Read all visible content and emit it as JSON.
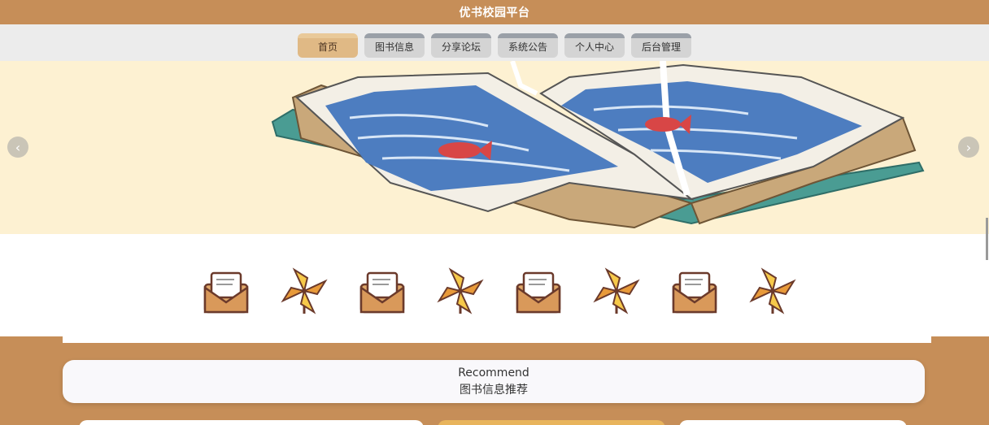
{
  "header": {
    "title": "优书校园平台"
  },
  "nav": {
    "items": [
      {
        "label": "首页",
        "active": true
      },
      {
        "label": "图书信息",
        "active": false
      },
      {
        "label": "分享论坛",
        "active": false
      },
      {
        "label": "系统公告",
        "active": false
      },
      {
        "label": "个人中心",
        "active": false
      },
      {
        "label": "后台管理",
        "active": false
      }
    ]
  },
  "banner": {
    "prev_icon": "chevron-left-icon",
    "next_icon": "chevron-right-icon"
  },
  "quick_icons": [
    "envelope-icon",
    "pinwheel-icon",
    "envelope-icon",
    "pinwheel-icon",
    "envelope-icon",
    "pinwheel-icon",
    "envelope-icon",
    "pinwheel-icon"
  ],
  "recommend": {
    "en": "Recommend",
    "zh": "图书信息推荐"
  },
  "colors": {
    "brand": "#c68e58",
    "nav_bg": "#ececec",
    "banner_bg": "#fdf1d2"
  }
}
